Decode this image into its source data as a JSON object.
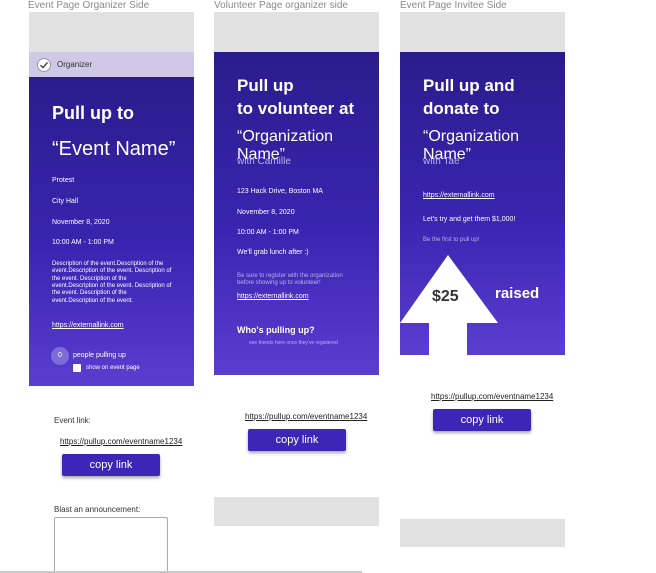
{
  "frames": {
    "organizer": {
      "label": "Event Page Organizer Side"
    },
    "volunteer": {
      "label": "Volunteer Page organizer side"
    },
    "invitee": {
      "label": "Event Page Invitee Side"
    }
  },
  "organizer_card": {
    "badge": "Organizer",
    "title_line1": "Pull up to",
    "title_line2": "“Event Name”",
    "type": "Protest",
    "location": "City Hall",
    "date": "November 8, 2020",
    "time": "10:00 AM - 1:00 PM",
    "description": "Description of the event.Description of the event.Description of the event. Description of the event. Description of the event.Description of the event. Description of the event. Description of the event.Description of the event.",
    "external_link": "https://externallink.com",
    "people_count": "0",
    "people_label": "people pulling up",
    "show_label": "show on event page",
    "event_link_label": "Event link:",
    "event_link": "https://pullup.com/eventname1234",
    "copy_button": "copy link",
    "blast_label": "Blast an announcement:"
  },
  "volunteer_card": {
    "title_line1": "Pull up",
    "title_line2": "to volunteer at",
    "title_line3": "“Organization Name”",
    "with": "with Camille",
    "address": "123 Hack Drive, Boston MA",
    "date": "November 8, 2020",
    "time": "10:00 AM - 1:00 PM",
    "note": "We'll grab lunch after :)",
    "register_note": "Be sure to register with the organization before showing up to volunteer!",
    "external_link": "https://externallink.com",
    "who_heading": "Who's pulling up?",
    "who_sub": "see friends here once they've registered",
    "event_link": "https://pullup.com/eventname1234",
    "copy_button": "copy link"
  },
  "invitee_card": {
    "title_line1": "Pull up and",
    "title_line2": "donate to",
    "title_line3": "“Organization Name”",
    "with": "with Tae",
    "external_link": "https://externallink.com",
    "goal": "Let's try and get them $1,000!",
    "first": "Be the first to pull up!",
    "amount": "$25",
    "raised": "raised",
    "event_link": "https://pullup.com/eventname1234",
    "copy_button": "copy link"
  }
}
